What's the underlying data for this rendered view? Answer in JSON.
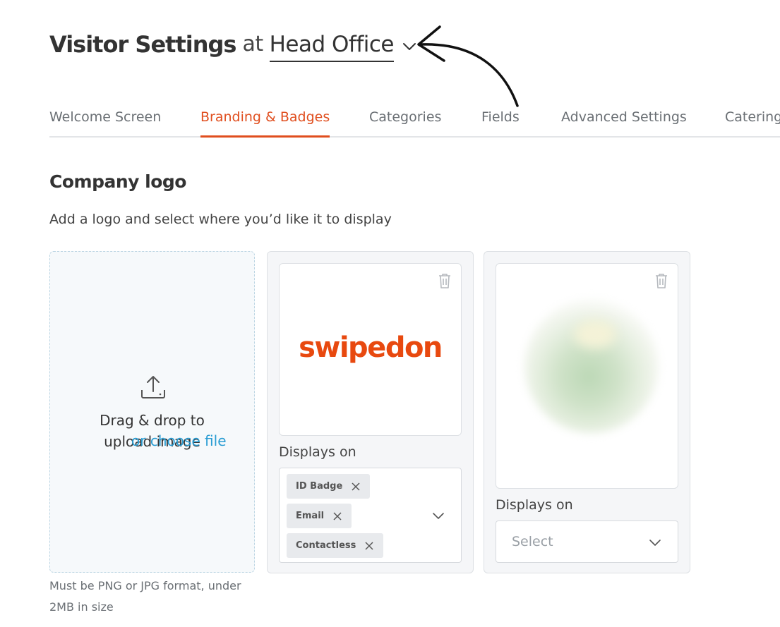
{
  "header": {
    "title": "Visitor Settings",
    "at_label": "at",
    "location": "Head Office"
  },
  "tabs": [
    {
      "label": "Welcome Screen",
      "active": false
    },
    {
      "label": "Branding & Badges",
      "active": true
    },
    {
      "label": "Categories",
      "active": false
    },
    {
      "label": "Fields",
      "active": false
    },
    {
      "label": "Advanced Settings",
      "active": false
    },
    {
      "label": "Catering",
      "active": false
    }
  ],
  "section": {
    "title": "Company logo",
    "subtitle": "Add a logo and select where you’d like it to display"
  },
  "upload": {
    "drop_text": "Drag & drop to upload image",
    "choose_link": "or choose file",
    "hint": "Must be PNG or JPG format, under 2MB in size"
  },
  "logo_cards": [
    {
      "logo_text": "swipedon",
      "displays_on_label": "Displays on",
      "selected": [
        "ID Badge",
        "Email",
        "Contactless"
      ]
    },
    {
      "displays_on_label": "Displays on",
      "placeholder": "Select"
    }
  ],
  "colors": {
    "accent": "#e04e1e",
    "link": "#2a9dd3",
    "logo": "#e8490f"
  }
}
